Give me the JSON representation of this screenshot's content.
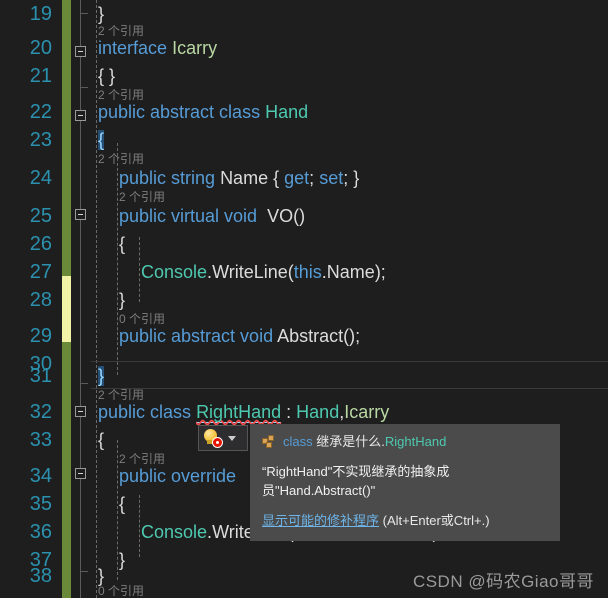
{
  "editor": {
    "language": "csharp",
    "theme": "dark",
    "background_color": "#1e1e1e",
    "linenumber_color": "#2b91af",
    "change_bar_saved_color": "#6a8a3a",
    "change_bar_unsaved_color": "#f0f0a0",
    "lines": [
      {
        "no": "19",
        "code_html": "}"
      },
      {
        "no": "20",
        "code_html": "interface Icarry"
      },
      {
        "no": "21",
        "code_html": "{ }"
      },
      {
        "no": "22",
        "code_html": "public abstract class Hand"
      },
      {
        "no": "23",
        "code_html": "{"
      },
      {
        "no": "24",
        "code_html": "public string Name { get; set; }"
      },
      {
        "no": "25",
        "code_html": "public virtual void  VO()"
      },
      {
        "no": "26",
        "code_html": "{"
      },
      {
        "no": "27",
        "code_html": "Console.WriteLine(this.Name);"
      },
      {
        "no": "28",
        "code_html": "}"
      },
      {
        "no": "29",
        "code_html": "public abstract void Abstract();"
      },
      {
        "no": "30",
        "code_html": ""
      },
      {
        "no": "31",
        "code_html": "}"
      },
      {
        "no": "32",
        "code_html": "public class RightHand : Hand,Icarry"
      },
      {
        "no": "33",
        "code_html": "{"
      },
      {
        "no": "34",
        "code_html": "public override"
      },
      {
        "no": "35",
        "code_html": "{"
      },
      {
        "no": "36",
        "code_html": "Console.WriteLine(\"我是右手啦啦啦\");"
      },
      {
        "no": "37",
        "code_html": "}"
      },
      {
        "no": "38",
        "code_html": "}"
      }
    ],
    "codelens": {
      "two_refs": "2 个引用",
      "zero_refs": "0 个引用"
    }
  },
  "quick_action": {
    "icon": "lightbulb-error-icon",
    "dropdown_icon": "chevron-down-icon"
  },
  "tooltip": {
    "icon": "class-icon",
    "signature_keyword": "class",
    "signature_namespace": "继承是什么.",
    "signature_type": "RightHand",
    "message": "“RightHand\"不实现继承的抽象成员\"Hand.Abstract()\"",
    "fix_link": "显示可能的修补程序",
    "fix_keys": "(Alt+Enter或Ctrl+.)"
  },
  "watermark": {
    "text": "CSDN @码农Giao哥哥"
  }
}
